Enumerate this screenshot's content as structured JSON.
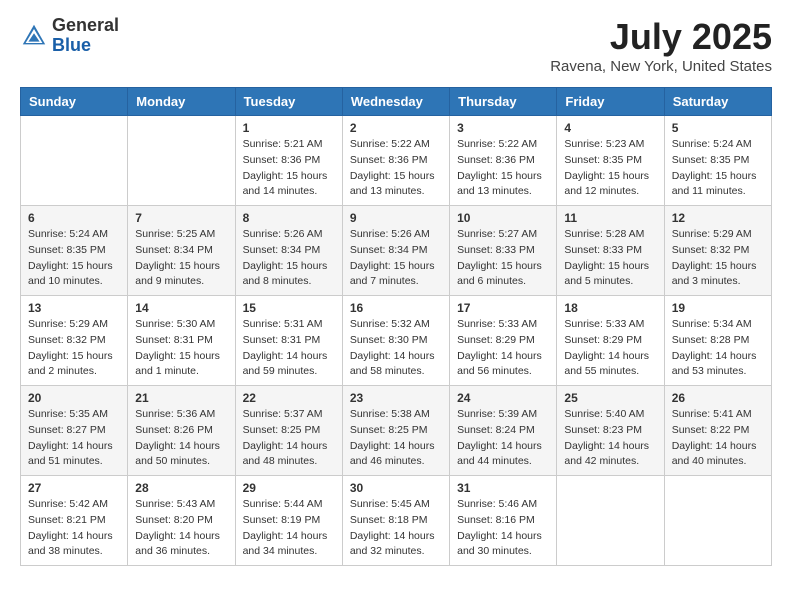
{
  "header": {
    "logo_general": "General",
    "logo_blue": "Blue",
    "title": "July 2025",
    "subtitle": "Ravena, New York, United States"
  },
  "calendar": {
    "days_of_week": [
      "Sunday",
      "Monday",
      "Tuesday",
      "Wednesday",
      "Thursday",
      "Friday",
      "Saturday"
    ],
    "weeks": [
      [
        {
          "day": "",
          "sunrise": "",
          "sunset": "",
          "daylight": ""
        },
        {
          "day": "",
          "sunrise": "",
          "sunset": "",
          "daylight": ""
        },
        {
          "day": "1",
          "sunrise": "Sunrise: 5:21 AM",
          "sunset": "Sunset: 8:36 PM",
          "daylight": "Daylight: 15 hours and 14 minutes."
        },
        {
          "day": "2",
          "sunrise": "Sunrise: 5:22 AM",
          "sunset": "Sunset: 8:36 PM",
          "daylight": "Daylight: 15 hours and 13 minutes."
        },
        {
          "day": "3",
          "sunrise": "Sunrise: 5:22 AM",
          "sunset": "Sunset: 8:36 PM",
          "daylight": "Daylight: 15 hours and 13 minutes."
        },
        {
          "day": "4",
          "sunrise": "Sunrise: 5:23 AM",
          "sunset": "Sunset: 8:35 PM",
          "daylight": "Daylight: 15 hours and 12 minutes."
        },
        {
          "day": "5",
          "sunrise": "Sunrise: 5:24 AM",
          "sunset": "Sunset: 8:35 PM",
          "daylight": "Daylight: 15 hours and 11 minutes."
        }
      ],
      [
        {
          "day": "6",
          "sunrise": "Sunrise: 5:24 AM",
          "sunset": "Sunset: 8:35 PM",
          "daylight": "Daylight: 15 hours and 10 minutes."
        },
        {
          "day": "7",
          "sunrise": "Sunrise: 5:25 AM",
          "sunset": "Sunset: 8:34 PM",
          "daylight": "Daylight: 15 hours and 9 minutes."
        },
        {
          "day": "8",
          "sunrise": "Sunrise: 5:26 AM",
          "sunset": "Sunset: 8:34 PM",
          "daylight": "Daylight: 15 hours and 8 minutes."
        },
        {
          "day": "9",
          "sunrise": "Sunrise: 5:26 AM",
          "sunset": "Sunset: 8:34 PM",
          "daylight": "Daylight: 15 hours and 7 minutes."
        },
        {
          "day": "10",
          "sunrise": "Sunrise: 5:27 AM",
          "sunset": "Sunset: 8:33 PM",
          "daylight": "Daylight: 15 hours and 6 minutes."
        },
        {
          "day": "11",
          "sunrise": "Sunrise: 5:28 AM",
          "sunset": "Sunset: 8:33 PM",
          "daylight": "Daylight: 15 hours and 5 minutes."
        },
        {
          "day": "12",
          "sunrise": "Sunrise: 5:29 AM",
          "sunset": "Sunset: 8:32 PM",
          "daylight": "Daylight: 15 hours and 3 minutes."
        }
      ],
      [
        {
          "day": "13",
          "sunrise": "Sunrise: 5:29 AM",
          "sunset": "Sunset: 8:32 PM",
          "daylight": "Daylight: 15 hours and 2 minutes."
        },
        {
          "day": "14",
          "sunrise": "Sunrise: 5:30 AM",
          "sunset": "Sunset: 8:31 PM",
          "daylight": "Daylight: 15 hours and 1 minute."
        },
        {
          "day": "15",
          "sunrise": "Sunrise: 5:31 AM",
          "sunset": "Sunset: 8:31 PM",
          "daylight": "Daylight: 14 hours and 59 minutes."
        },
        {
          "day": "16",
          "sunrise": "Sunrise: 5:32 AM",
          "sunset": "Sunset: 8:30 PM",
          "daylight": "Daylight: 14 hours and 58 minutes."
        },
        {
          "day": "17",
          "sunrise": "Sunrise: 5:33 AM",
          "sunset": "Sunset: 8:29 PM",
          "daylight": "Daylight: 14 hours and 56 minutes."
        },
        {
          "day": "18",
          "sunrise": "Sunrise: 5:33 AM",
          "sunset": "Sunset: 8:29 PM",
          "daylight": "Daylight: 14 hours and 55 minutes."
        },
        {
          "day": "19",
          "sunrise": "Sunrise: 5:34 AM",
          "sunset": "Sunset: 8:28 PM",
          "daylight": "Daylight: 14 hours and 53 minutes."
        }
      ],
      [
        {
          "day": "20",
          "sunrise": "Sunrise: 5:35 AM",
          "sunset": "Sunset: 8:27 PM",
          "daylight": "Daylight: 14 hours and 51 minutes."
        },
        {
          "day": "21",
          "sunrise": "Sunrise: 5:36 AM",
          "sunset": "Sunset: 8:26 PM",
          "daylight": "Daylight: 14 hours and 50 minutes."
        },
        {
          "day": "22",
          "sunrise": "Sunrise: 5:37 AM",
          "sunset": "Sunset: 8:25 PM",
          "daylight": "Daylight: 14 hours and 48 minutes."
        },
        {
          "day": "23",
          "sunrise": "Sunrise: 5:38 AM",
          "sunset": "Sunset: 8:25 PM",
          "daylight": "Daylight: 14 hours and 46 minutes."
        },
        {
          "day": "24",
          "sunrise": "Sunrise: 5:39 AM",
          "sunset": "Sunset: 8:24 PM",
          "daylight": "Daylight: 14 hours and 44 minutes."
        },
        {
          "day": "25",
          "sunrise": "Sunrise: 5:40 AM",
          "sunset": "Sunset: 8:23 PM",
          "daylight": "Daylight: 14 hours and 42 minutes."
        },
        {
          "day": "26",
          "sunrise": "Sunrise: 5:41 AM",
          "sunset": "Sunset: 8:22 PM",
          "daylight": "Daylight: 14 hours and 40 minutes."
        }
      ],
      [
        {
          "day": "27",
          "sunrise": "Sunrise: 5:42 AM",
          "sunset": "Sunset: 8:21 PM",
          "daylight": "Daylight: 14 hours and 38 minutes."
        },
        {
          "day": "28",
          "sunrise": "Sunrise: 5:43 AM",
          "sunset": "Sunset: 8:20 PM",
          "daylight": "Daylight: 14 hours and 36 minutes."
        },
        {
          "day": "29",
          "sunrise": "Sunrise: 5:44 AM",
          "sunset": "Sunset: 8:19 PM",
          "daylight": "Daylight: 14 hours and 34 minutes."
        },
        {
          "day": "30",
          "sunrise": "Sunrise: 5:45 AM",
          "sunset": "Sunset: 8:18 PM",
          "daylight": "Daylight: 14 hours and 32 minutes."
        },
        {
          "day": "31",
          "sunrise": "Sunrise: 5:46 AM",
          "sunset": "Sunset: 8:16 PM",
          "daylight": "Daylight: 14 hours and 30 minutes."
        },
        {
          "day": "",
          "sunrise": "",
          "sunset": "",
          "daylight": ""
        },
        {
          "day": "",
          "sunrise": "",
          "sunset": "",
          "daylight": ""
        }
      ]
    ]
  }
}
